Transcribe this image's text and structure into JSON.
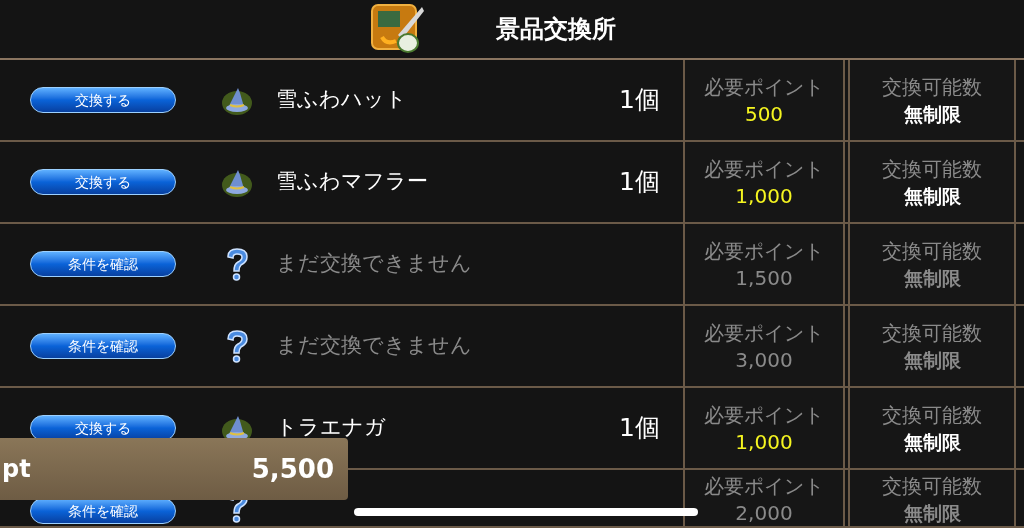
{
  "header": {
    "title": "景品交換所"
  },
  "rows": [
    {
      "kind": "exchange",
      "button": "交換する",
      "name": "雪ふわハット",
      "count": "1個",
      "points_label": "必要ポイント",
      "points": "500",
      "limit_label": "交換可能数",
      "limit": "無制限"
    },
    {
      "kind": "exchange",
      "button": "交換する",
      "name": "雪ふわマフラー",
      "count": "1個",
      "points_label": "必要ポイント",
      "points": "1,000",
      "limit_label": "交換可能数",
      "limit": "無制限"
    },
    {
      "kind": "locked",
      "button": "条件を確認",
      "name": "まだ交換できません",
      "points_label": "必要ポイント",
      "points": "1,500",
      "limit_label": "交換可能数",
      "limit": "無制限"
    },
    {
      "kind": "locked",
      "button": "条件を確認",
      "name": "まだ交換できません",
      "points_label": "必要ポイント",
      "points": "3,000",
      "limit_label": "交換可能数",
      "limit": "無制限"
    },
    {
      "kind": "exchange",
      "button": "交換する",
      "name": "トラエナガ",
      "count": "1個",
      "points_label": "必要ポイント",
      "points": "1,000",
      "limit_label": "交換可能数",
      "limit": "無制限"
    },
    {
      "kind": "locked",
      "button": "条件を確認",
      "points_label": "必要ポイント",
      "points": "2,000",
      "limit_label": "交換可能数",
      "limit": "無制限"
    }
  ],
  "points_panel": {
    "unit": "pt",
    "value": "5,500"
  }
}
